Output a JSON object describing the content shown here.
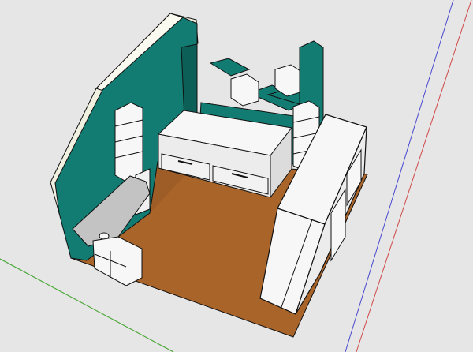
{
  "viewport": {
    "background": "#e6e6e6",
    "axes": {
      "red": "#d04848",
      "green": "#3cb83c",
      "blue": "#4848d0"
    }
  },
  "model": {
    "colors": {
      "floor": "#a9642a",
      "floor_dark": "#8a4e1f",
      "teal": "#137c72",
      "teal_dark": "#0c5f57",
      "white": "#f7f7f7",
      "cream": "#f1f1e2",
      "grey": "#c3c3c3",
      "outline": "#111111"
    },
    "objects": [
      "floor",
      "back-wall-teal",
      "sloped-roof-panel",
      "bed",
      "bed-drawer-left",
      "bed-drawer-right",
      "desk",
      "desk-cabinet",
      "desk-shelf-unit",
      "wall-shelves",
      "bookshelf-tower",
      "wardrobe"
    ]
  }
}
